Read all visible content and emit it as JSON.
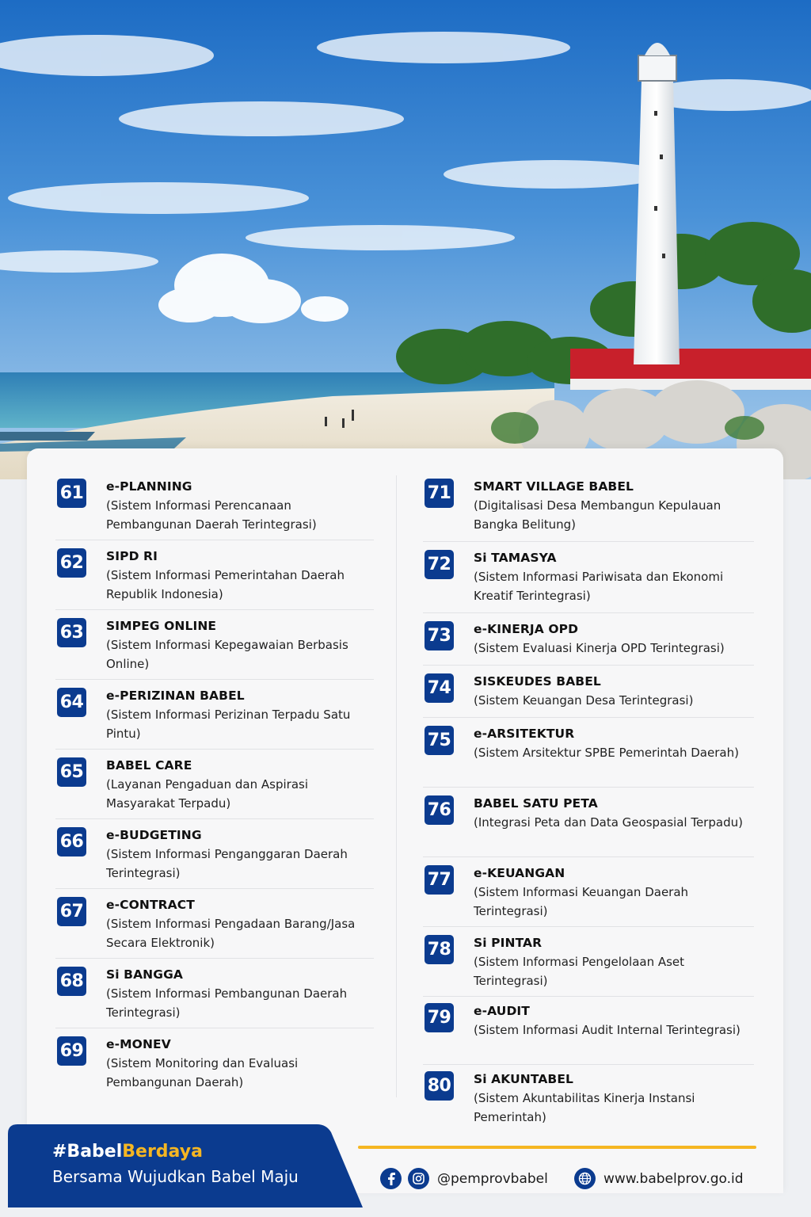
{
  "left_items": [
    {
      "number": "61",
      "name": "e-PLANNING",
      "desc": "(Sistem Informasi Perencanaan Pembangunan Daerah Terintegrasi)"
    },
    {
      "number": "62",
      "name": "SIPD RI",
      "desc": "(Sistem Informasi Pemerintahan Daerah Republik Indonesia)"
    },
    {
      "number": "63",
      "name": "SIMPEG ONLINE",
      "desc": "(Sistem Informasi Kepegawaian Berbasis Online)"
    },
    {
      "number": "64",
      "name": "e-PERIZINAN BABEL",
      "desc": "(Sistem Informasi Perizinan Terpadu Satu Pintu)"
    },
    {
      "number": "65",
      "name": "BABEL CARE",
      "desc": "(Layanan Pengaduan dan Aspirasi Masyarakat Terpadu)"
    },
    {
      "number": "66",
      "name": "e-BUDGETING",
      "desc": "(Sistem Informasi Penganggaran Daerah Terintegrasi)"
    },
    {
      "number": "67",
      "name": "e-CONTRACT",
      "desc": "(Sistem Informasi Pengadaan Barang/Jasa Secara Elektronik)"
    },
    {
      "number": "68",
      "name": "Si BANGGA",
      "desc": "(Sistem Informasi Pembangunan Daerah Terintegrasi)"
    },
    {
      "number": "69",
      "name": "e-MONEV",
      "desc": "(Sistem Monitoring dan Evaluasi Pembangunan Daerah)"
    }
  ],
  "right_items": [
    {
      "number": "71",
      "name": "SMART VILLAGE BABEL",
      "desc": "(Digitalisasi Desa Membangun Kepulauan Bangka Belitung)"
    },
    {
      "number": "72",
      "name": "Si TAMASYA",
      "desc": "(Sistem Informasi Pariwisata dan Ekonomi Kreatif Terintegrasi)"
    },
    {
      "number": "73",
      "name": "e-KINERJA OPD",
      "desc": "(Sistem Evaluasi Kinerja OPD Terintegrasi)"
    },
    {
      "number": "74",
      "name": "SISKEUDES BABEL",
      "desc": "(Sistem Keuangan Desa Terintegrasi)"
    },
    {
      "number": "75",
      "name": "e-ARSITEKTUR",
      "desc": "(Sistem Arsitektur SPBE Pemerintah Daerah)"
    },
    {
      "number": "76",
      "name": "BABEL SATU PETA",
      "desc": "(Integrasi Peta dan Data Geospasial Terpadu)"
    },
    {
      "number": "77",
      "name": "e-KEUANGAN",
      "desc": "(Sistem Informasi Keuangan Daerah Terintegrasi)"
    },
    {
      "number": "78",
      "name": "Si PINTAR",
      "desc": "(Sistem Informasi Pengelolaan Aset Terintegrasi)"
    },
    {
      "number": "79",
      "name": "e-AUDIT",
      "desc": "(Sistem Informasi Audit Internal Terintegrasi)"
    },
    {
      "number": "80",
      "name": "Si AKUNTABEL",
      "desc": "(Sistem Akuntabilitas Kinerja Instansi Pemerintah)"
    }
  ],
  "footer": {
    "hashtag_prefix": "#Babel",
    "hashtag_accent": "Berdaya",
    "tagline": "Bersama Wujudkan Babel Maju",
    "social_handle": "@pemprovbabel",
    "website": "www.babelprov.go.id"
  },
  "icons": {
    "facebook": "facebook-icon",
    "instagram": "instagram-icon",
    "globe": "globe-icon"
  },
  "colors": {
    "badge": "#0b3b8f",
    "accent": "#f5b622",
    "panel": "#0b3b8f"
  }
}
